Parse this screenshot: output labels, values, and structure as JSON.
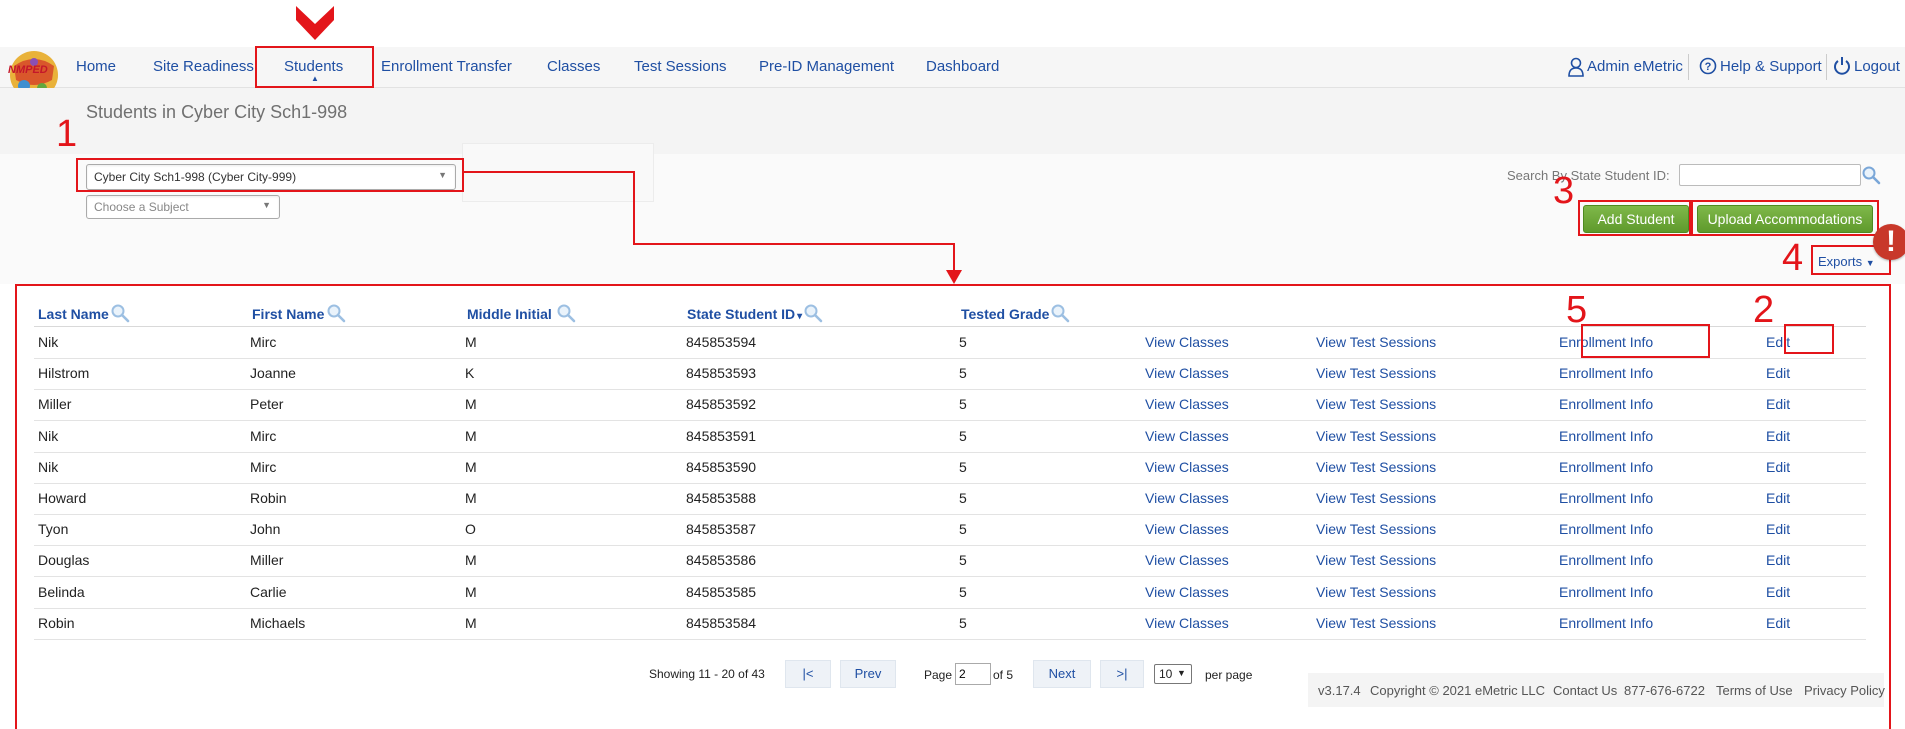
{
  "nav": {
    "items": [
      "Home",
      "Site Readiness",
      "Students",
      "Enrollment Transfer",
      "Classes",
      "Test Sessions",
      "Pre-ID Management",
      "Dashboard"
    ],
    "user": "Admin eMetric",
    "help": "Help & Support",
    "logout": "Logout",
    "logo_text": "NMPED"
  },
  "page": {
    "title": "Students in Cyber City Sch1-998"
  },
  "filters": {
    "school_select": "Cyber City Sch1-998 (Cyber City-999)",
    "subject_select": "Choose a Subject"
  },
  "search": {
    "label": "Search By State Student ID:",
    "value": ""
  },
  "buttons": {
    "add_student": "Add Student",
    "upload_accommodations": "Upload Accommodations",
    "exports": "Exports"
  },
  "table": {
    "columns": [
      "Last Name",
      "First Name",
      "Middle Initial",
      "State Student ID",
      "Tested Grade"
    ],
    "sort_indicator": "▾",
    "link_labels": {
      "classes": "View Classes",
      "sessions": "View Test Sessions",
      "enrollment": "Enrollment Info",
      "edit": "Edit"
    },
    "rows": [
      {
        "last": "Nik",
        "first": "Mirc",
        "middle": "M",
        "id": "845853594",
        "grade": "5"
      },
      {
        "last": "Hilstrom",
        "first": "Joanne",
        "middle": "K",
        "id": "845853593",
        "grade": "5"
      },
      {
        "last": "Miller",
        "first": "Peter",
        "middle": "M",
        "id": "845853592",
        "grade": "5"
      },
      {
        "last": "Nik",
        "first": "Mirc",
        "middle": "M",
        "id": "845853591",
        "grade": "5"
      },
      {
        "last": "Nik",
        "first": "Mirc",
        "middle": "M",
        "id": "845853590",
        "grade": "5"
      },
      {
        "last": "Howard",
        "first": "Robin",
        "middle": "M",
        "id": "845853588",
        "grade": "5"
      },
      {
        "last": "Tyon",
        "first": "John",
        "middle": "O",
        "id": "845853587",
        "grade": "5"
      },
      {
        "last": "Douglas",
        "first": "Miller",
        "middle": "M",
        "id": "845853586",
        "grade": "5"
      },
      {
        "last": "Belinda",
        "first": "Carlie",
        "middle": "M",
        "id": "845853585",
        "grade": "5"
      },
      {
        "last": "Robin",
        "first": "Michaels",
        "middle": "M",
        "id": "845853584",
        "grade": "5"
      }
    ]
  },
  "pagination": {
    "showing": "Showing 11 - 20 of 43",
    "first": "|<",
    "prev": "Prev",
    "page_label": "Page",
    "page_value": "2",
    "of_label": "of 5",
    "next": "Next",
    "last": ">|",
    "per_page_value": "10",
    "per_page_label": "per page"
  },
  "footer": {
    "version": "v3.17.4",
    "copyright": "Copyright © 2021 eMetric LLC",
    "contact": "Contact Us",
    "phone": "877-676-6722",
    "terms": "Terms of Use",
    "privacy": "Privacy Policy"
  },
  "annotations": {
    "n1": "1",
    "n2": "2",
    "n3": "3",
    "n4": "4",
    "n5": "5",
    "alert": "!",
    "color": "#e3151a"
  }
}
